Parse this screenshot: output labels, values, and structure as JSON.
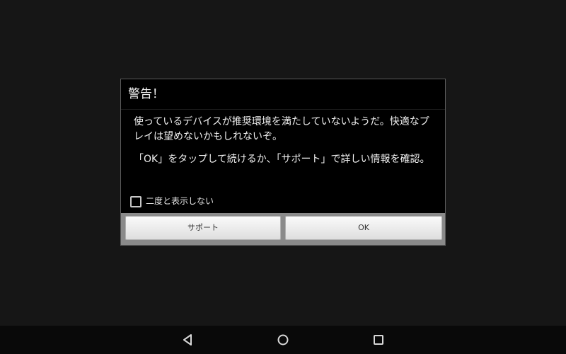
{
  "dialog": {
    "title": "警告！",
    "message_1": "使っているデバイスが推奨環境を満たしていないようだ。快適なプレイは望めないかもしれないぞ。",
    "message_2": "「OK」をタップして続けるか、「サポート」で詳しい情報を確認。",
    "checkbox": {
      "label": "二度と表示しない",
      "checked": false
    },
    "buttons": {
      "support": "サポート",
      "ok": "OK"
    }
  },
  "navigation_bar": {
    "icons": [
      "back-icon",
      "home-icon",
      "recents-icon"
    ]
  },
  "colors": {
    "background": "#161616",
    "dialog_background": "#000000",
    "button_bar": "#8a8a8a",
    "navbar": "#090909"
  }
}
